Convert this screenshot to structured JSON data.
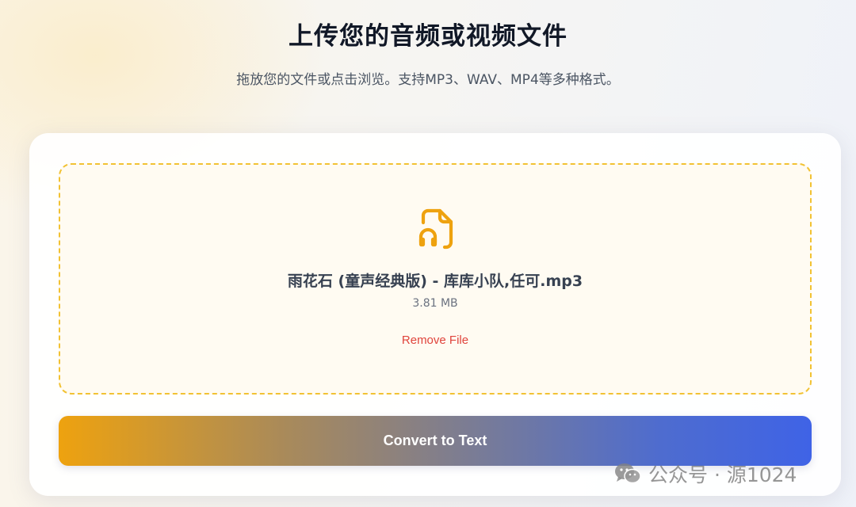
{
  "header": {
    "title": "上传您的音频或视频文件",
    "subtitle": "拖放您的文件或点击浏览。支持MP3、WAV、MP4等多种格式。"
  },
  "upload": {
    "file_icon": "audio-file-icon",
    "file_name": "雨花石 (童声经典版) - 库库小队,任可.mp3",
    "file_size": "3.81 MB",
    "remove_label": "Remove File"
  },
  "actions": {
    "convert_label": "Convert to Text"
  },
  "watermark": {
    "icon": "wechat-icon",
    "text": "公众号 · 源1024"
  },
  "colors": {
    "accent": "#eea20f",
    "dropzone_border": "#f2c233",
    "remove": "#e0443c",
    "button_gradient_end": "#3f63e6"
  }
}
